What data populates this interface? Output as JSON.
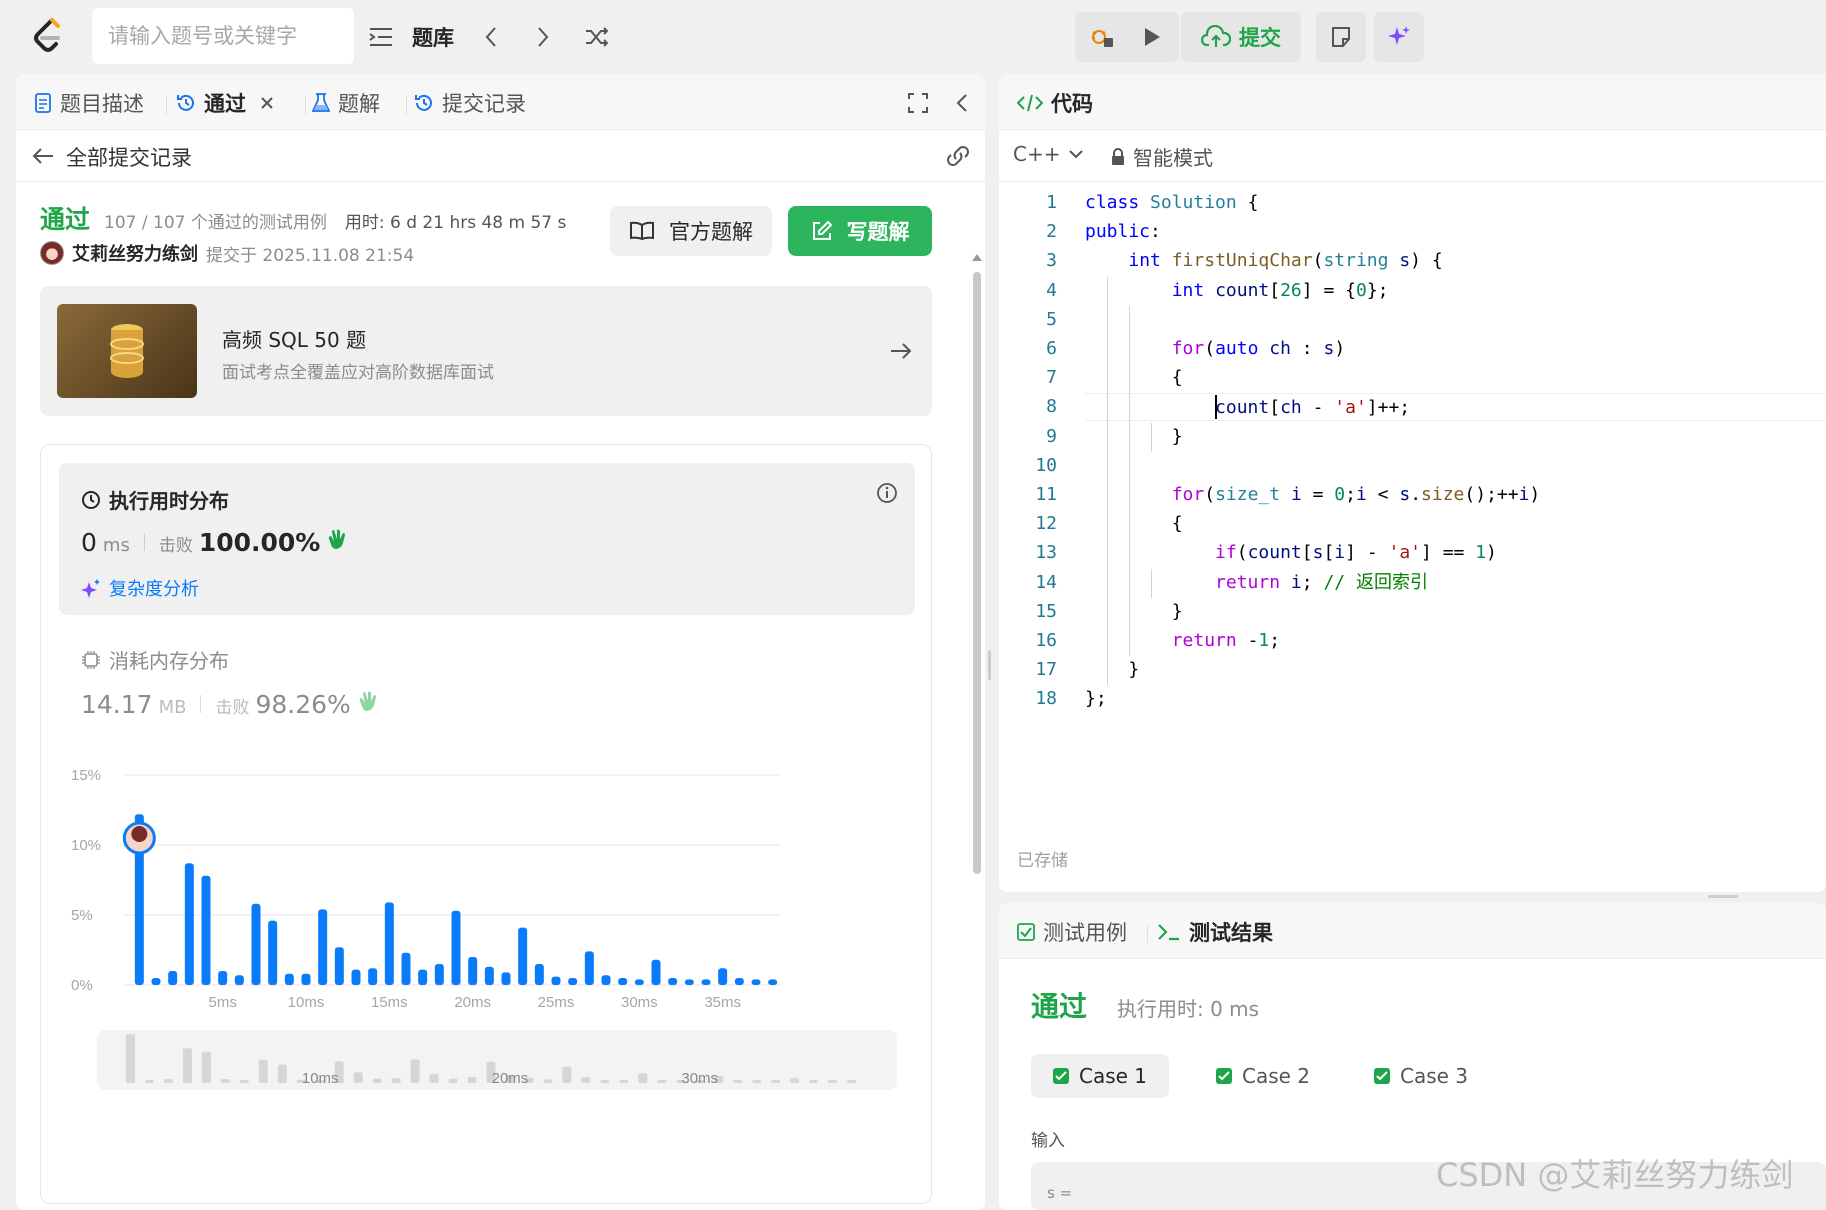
{
  "topbar": {
    "search_placeholder": "请输入题号或关键字",
    "problem_list_label": "题库",
    "submit_label": "提交"
  },
  "left": {
    "tabs": [
      {
        "label": "题目描述"
      },
      {
        "label": "通过"
      },
      {
        "label": "题解"
      },
      {
        "label": "提交记录"
      }
    ],
    "back_label": "全部提交记录",
    "status": "通过",
    "testcases": "107 / 107 个通过的测试用例",
    "elapsed_label": "用时: 6 d 21 hrs 48 m 57 s",
    "user": "艾莉丝努力练剑",
    "submitted_at": "提交于 2025.11.08 21:54",
    "official_solution_label": "官方题解",
    "write_solution_label": "写题解",
    "promo": {
      "title": "高频 SQL 50 题",
      "subtitle": "面试考点全覆盖应对高阶数据库面试"
    },
    "runtime": {
      "title": "执行用时分布",
      "value": "0",
      "unit": "ms",
      "beats_label": "击败",
      "beats": "100.00%",
      "complexity_label": "复杂度分析"
    },
    "memory": {
      "title": "消耗内存分布",
      "value": "14.17",
      "unit": "MB",
      "beats_label": "击败",
      "beats": "98.26%"
    }
  },
  "chart_data": {
    "type": "bar",
    "xlabel": "",
    "ylabel": "",
    "y_ticks": [
      "15%",
      "10%",
      "5%",
      "0%"
    ],
    "x_ticks": [
      "5ms",
      "10ms",
      "15ms",
      "20ms",
      "25ms",
      "30ms",
      "35ms"
    ],
    "mini_ticks": [
      "10ms",
      "20ms",
      "30ms"
    ],
    "ylim": [
      0,
      15
    ],
    "x": [
      0,
      1,
      2,
      3,
      4,
      5,
      6,
      7,
      8,
      9,
      10,
      11,
      12,
      13,
      14,
      15,
      16,
      17,
      18,
      19,
      20,
      21,
      22,
      23,
      24,
      25,
      26,
      27,
      28,
      29,
      30,
      31,
      32,
      33,
      34,
      35,
      36,
      37,
      38
    ],
    "values": [
      12.2,
      0.5,
      1.0,
      8.7,
      7.8,
      1.0,
      0.7,
      5.8,
      4.6,
      0.8,
      0.8,
      5.4,
      2.7,
      1.1,
      1.2,
      5.9,
      2.3,
      1.1,
      1.5,
      5.3,
      2.0,
      1.3,
      0.9,
      4.1,
      1.5,
      0.6,
      0.5,
      2.4,
      0.7,
      0.5,
      0.4,
      1.8,
      0.5,
      0.4,
      0.4,
      1.2,
      0.5,
      0.4,
      0.4
    ],
    "highlight_x": 0,
    "bar_color": "#0a7cf9",
    "grid": true
  },
  "editor": {
    "title": "代码",
    "language": "C++",
    "mode": "智能模式",
    "saved_label": "已存储",
    "lines": [
      "class Solution {",
      "public:",
      "    int firstUniqChar(string s) {",
      "        int count[26] = {0};",
      "",
      "        for(auto ch : s)",
      "        {",
      "            count[ch - 'a']++;",
      "        }",
      "",
      "        for(size_t i = 0;i < s.size();++i)",
      "        {",
      "            if(count[s[i] - 'a'] == 1)",
      "            return i; // 返回索引",
      "        }",
      "        return -1;",
      "    }",
      "};"
    ]
  },
  "result": {
    "tab_cases": "测试用例",
    "tab_result": "测试结果",
    "status": "通过",
    "runtime": "执行用时: 0 ms",
    "cases": [
      "Case 1",
      "Case 2",
      "Case 3"
    ],
    "input_label": "输入",
    "input_value": "s ="
  },
  "watermark": "CSDN @艾莉丝努力练剑",
  "colors": {
    "accent_green": "#1ea54a",
    "bar_blue": "#0a7cf9",
    "link_blue": "#0a7cf9"
  }
}
